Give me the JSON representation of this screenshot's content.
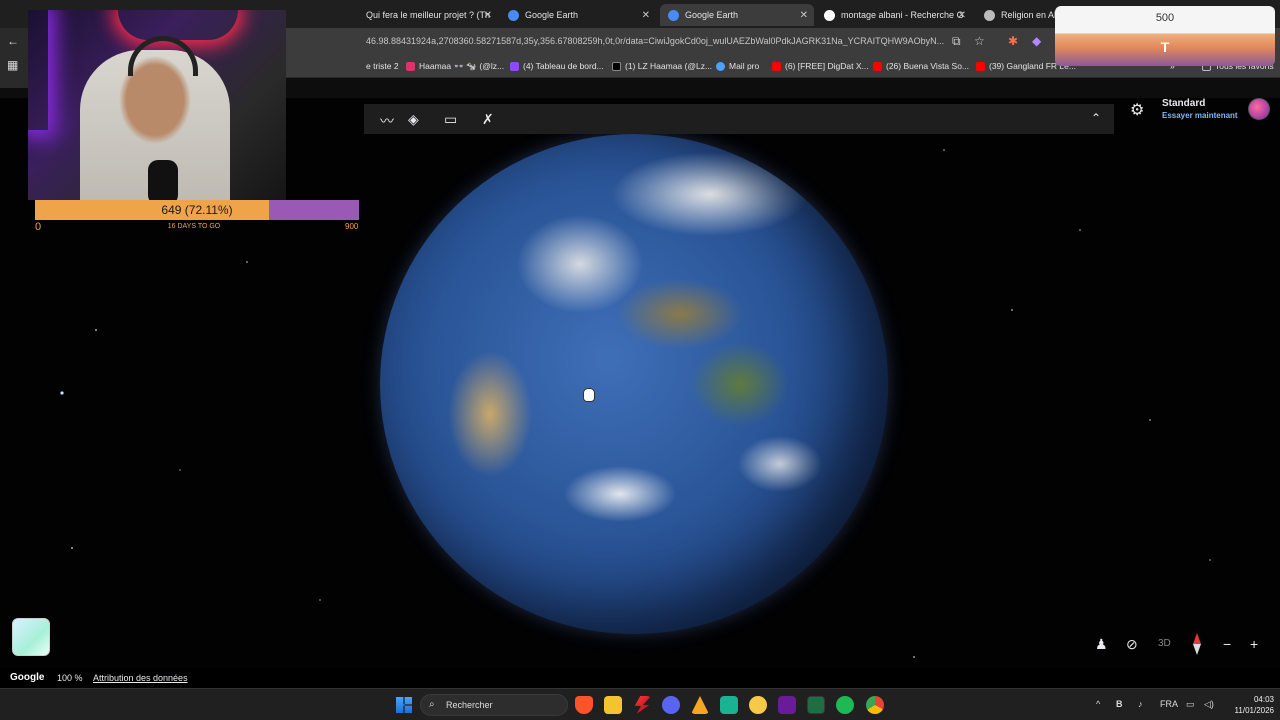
{
  "browser": {
    "tabs": [
      {
        "title": "Qui fera le meilleur projet ? (Th",
        "active": false
      },
      {
        "title": "Google Earth",
        "active": false
      },
      {
        "title": "Google Earth",
        "active": true
      },
      {
        "title": "montage albani - Recherche G",
        "active": false
      },
      {
        "title": "Religion en Alba",
        "active": false
      }
    ],
    "url": "46.98.88431924a,2708360.58271587d,35y,356.67808259h,0t,0r/data=CiwiJgokCd0oj_wulUAEZbWal0PdkJAGRK31Na_YCRAITQHW9AObyN...",
    "bookmarks": [
      {
        "label": "e triste 2",
        "color": "#888888"
      },
      {
        "label": "Haamaa 👓 🐄 (@lz...",
        "color": "#e1306c"
      },
      {
        "label": "(4) Tableau de bord...",
        "color": "#9146ff"
      },
      {
        "label": "(1) LZ Haamaa (@Lz...",
        "color": "#000000"
      },
      {
        "label": "Mail pro",
        "color": "#4aa3ff"
      },
      {
        "label": "(6) [FREE] DigDat X...",
        "color": "#ff0000"
      },
      {
        "label": "(26) Buena Vista So...",
        "color": "#ff0000"
      },
      {
        "label": "(39) Gangland FR Le...",
        "color": "#ff0000"
      }
    ],
    "all_bookmarks": "Tous les favoris"
  },
  "earth": {
    "plan_title": "Standard",
    "plan_sub": "Essayer maintenant",
    "zoom": "100 %",
    "attribution": "Attribution des données",
    "logo": "Google",
    "mode_3d": "3D"
  },
  "overlay": {
    "goal_label": "649 (72.11%)",
    "goal_fraction": 0.7211,
    "goal_min": "0",
    "goal_mid": "16 DAYS TO GO",
    "goal_max": "900",
    "widget_number": "500",
    "widget_letter": "T"
  },
  "taskbar": {
    "search_label": "Rechercher",
    "lang": "FRA",
    "time": "04:03",
    "date": "11/01/2026"
  },
  "colors": {
    "accent": "#8ab4f8",
    "goal_fill": "#f0a44a",
    "goal_bg": "#9b59b6"
  }
}
